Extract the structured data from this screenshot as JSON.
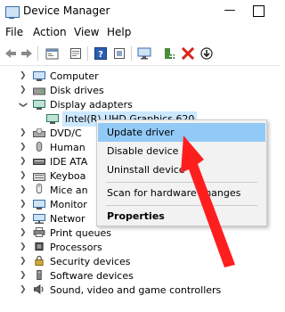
{
  "window": {
    "title": "Device Manager",
    "minimize_glyph": "—"
  },
  "menu": [
    "File",
    "Action",
    "View",
    "Help"
  ],
  "toolbar": {
    "icons": [
      "back-arrow-icon",
      "forward-arrow-icon",
      "computer-view-icon",
      "properties-icon",
      "help-icon",
      "device-view-icon",
      "monitor-scan-icon",
      "add-driver-icon",
      "uninstall-x-icon",
      "download-driver-icon"
    ],
    "danger_color": "#d9261c",
    "help_color": "#2a5db0"
  },
  "tree": [
    {
      "label": "Computer",
      "icon": "computer-icon",
      "expanded": false
    },
    {
      "label": "Disk drives",
      "icon": "disk-drive-icon",
      "expanded": false
    },
    {
      "label": "Display adapters",
      "icon": "display-adapter-icon",
      "expanded": true
    },
    {
      "label": "Intel(R) UHD Graphics 620",
      "icon": "display-adapter-icon",
      "child": true,
      "selected": true
    },
    {
      "label": "DVD/C",
      "icon": "dvd-drive-icon",
      "expanded": false
    },
    {
      "label": "Human",
      "icon": "hid-icon",
      "expanded": false
    },
    {
      "label": "IDE ATA",
      "icon": "ide-controller-icon",
      "expanded": false
    },
    {
      "label": "Keyboa",
      "icon": "keyboard-icon",
      "expanded": false
    },
    {
      "label": "Mice an",
      "icon": "mouse-icon",
      "expanded": false
    },
    {
      "label": "Monitor",
      "icon": "monitor-icon",
      "expanded": false
    },
    {
      "label": "Networ",
      "icon": "network-adapter-icon",
      "expanded": false
    },
    {
      "label": "Print queues",
      "icon": "printer-icon",
      "expanded": false
    },
    {
      "label": "Processors",
      "icon": "processor-icon",
      "expanded": false
    },
    {
      "label": "Security devices",
      "icon": "security-device-icon",
      "expanded": false
    },
    {
      "label": "Software devices",
      "icon": "software-device-icon",
      "expanded": false
    },
    {
      "label": "Sound, video and game controllers",
      "icon": "sound-icon",
      "expanded": false
    }
  ],
  "context_menu": {
    "items": [
      {
        "label": "Update driver",
        "highlighted": true
      },
      {
        "label": "Disable device"
      },
      {
        "label": "Uninstall device"
      },
      {
        "label": "Scan for hardware changes"
      },
      {
        "label": "Properties",
        "bold": true
      }
    ]
  },
  "annotation": {
    "color": "#ff1e1e",
    "icon": "red-arrow-icon"
  },
  "colors": {
    "selection": "#91c9f7",
    "menu_bg": "#f2f2f2"
  }
}
